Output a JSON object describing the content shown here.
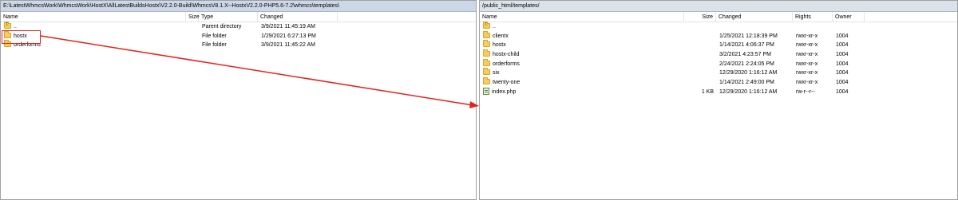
{
  "left_pane": {
    "path": "E:\\LatestWhmcsWork\\WhmcsWork\\HostX\\AllLatestBuildsHostx\\V2.2.0-Build\\WhmcsV8.1.X--HostxV2.2.0-PHP5.6-7.2\\whmcs\\templates\\",
    "columns": {
      "name": "Name",
      "size": "Size",
      "type": "Type",
      "changed": "Changed"
    },
    "rows": [
      {
        "name": "..",
        "size": "",
        "type": "Parent directory",
        "changed": "3/9/2021 11:45:19 AM",
        "icon": "parent-folder-icon"
      },
      {
        "name": "hostx",
        "size": "",
        "type": "File folder",
        "changed": "1/29/2021 6:27:13 PM",
        "icon": "folder-icon"
      },
      {
        "name": "orderforms",
        "size": "",
        "type": "File folder",
        "changed": "3/9/2021 11:45:22 AM",
        "icon": "folder-icon"
      }
    ]
  },
  "right_pane": {
    "path": "/public_html/templates/",
    "columns": {
      "name": "Name",
      "size": "Size",
      "changed": "Changed",
      "rights": "Rights",
      "owner": "Owner"
    },
    "rows": [
      {
        "name": "..",
        "size": "",
        "changed": "",
        "rights": "",
        "owner": "",
        "icon": "parent-folder-icon"
      },
      {
        "name": "clientx",
        "size": "",
        "changed": "1/25/2021 12:18:39 PM",
        "rights": "rwxr-xr-x",
        "owner": "1004",
        "icon": "folder-icon"
      },
      {
        "name": "hostx",
        "size": "",
        "changed": "1/14/2021 4:06:37 PM",
        "rights": "rwxr-xr-x",
        "owner": "1004",
        "icon": "folder-icon"
      },
      {
        "name": "hostx-child",
        "size": "",
        "changed": "3/2/2021 4:23:57 PM",
        "rights": "rwxr-xr-x",
        "owner": "1004",
        "icon": "folder-icon"
      },
      {
        "name": "orderforms",
        "size": "",
        "changed": "2/24/2021 2:24:05 PM",
        "rights": "rwxr-xr-x",
        "owner": "1004",
        "icon": "folder-icon"
      },
      {
        "name": "six",
        "size": "",
        "changed": "12/29/2020 1:16:12 AM",
        "rights": "rwxr-xr-x",
        "owner": "1004",
        "icon": "folder-icon"
      },
      {
        "name": "twenty-one",
        "size": "",
        "changed": "1/14/2021 2:49:00 PM",
        "rights": "rwxr-xr-x",
        "owner": "1004",
        "icon": "folder-icon"
      },
      {
        "name": "index.php",
        "size": "1 KB",
        "changed": "12/29/2020 1:16:12 AM",
        "rights": "rw-r--r--",
        "owner": "1004",
        "icon": "php-file-icon"
      }
    ]
  },
  "annotation": {
    "color": "#e2231a",
    "highlighted_item": "hostx"
  }
}
